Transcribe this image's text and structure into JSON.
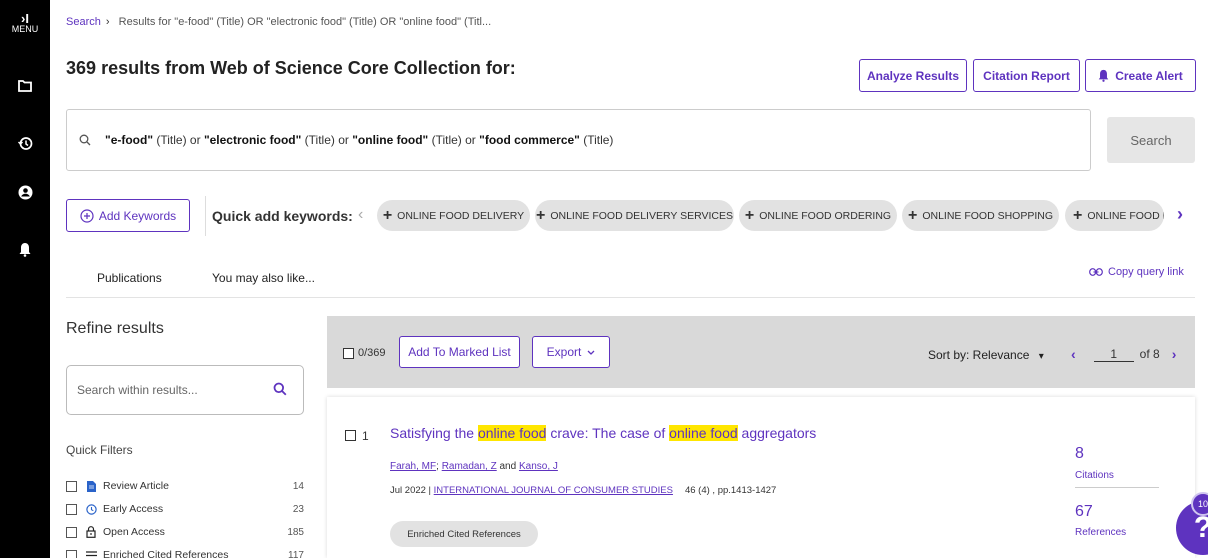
{
  "rail": {
    "menu_label": "MENU",
    "toggle_glyph": "›I",
    "icons": [
      "folder-icon",
      "history-icon",
      "account-icon",
      "bell-icon"
    ]
  },
  "breadcrumb": {
    "search": "Search",
    "separator": "›",
    "current": "Results for \"e-food\" (Title) OR \"electronic food\" (Title) OR \"online food\" (Titl..."
  },
  "header": {
    "count": "369",
    "title_rest": "results from Web of Science Core Collection for:",
    "analyze": "Analyze Results",
    "citation_report": "Citation Report",
    "create_alert": "Create Alert"
  },
  "query": {
    "t1": "\"e-food\"",
    "f1": " (Title) or ",
    "t2": "\"electronic food\"",
    "f2": " (Title) or ",
    "t3": "\"online food\"",
    "f3": " (Title) or ",
    "t4": "\"food commerce\"",
    "f4": " (Title)",
    "search_button": "Search"
  },
  "keywords": {
    "add_label": "Add Keywords",
    "quick_label": "Quick add keywords:",
    "chips": [
      "ONLINE FOOD DELIVERY",
      "ONLINE FOOD DELIVERY SERVICES",
      "ONLINE FOOD ORDERING",
      "ONLINE FOOD SHOPPING",
      "ONLINE FOOD D"
    ]
  },
  "tabs": {
    "publications": "Publications",
    "may_like": "You may also like...",
    "copy_link": "Copy query link"
  },
  "refine": {
    "title": "Refine results",
    "search_placeholder": "Search within results...",
    "quick_filters": "Quick Filters",
    "filters": [
      {
        "label": "Review Article",
        "count": "14",
        "icon": "document-icon"
      },
      {
        "label": "Early Access",
        "count": "23",
        "icon": "clock-icon"
      },
      {
        "label": "Open Access",
        "count": "185",
        "icon": "lock-icon"
      },
      {
        "label": "Enriched Cited References",
        "count": "117",
        "icon": "list-icon"
      }
    ]
  },
  "result_bar": {
    "selected": "0/369",
    "add_marked": "Add To Marked List",
    "export": "Export",
    "sort": "Sort by: Relevance",
    "sort_arrow": "▾",
    "page": "1",
    "of": "of 8"
  },
  "record": {
    "number": "1",
    "title_1": "Satisfying the ",
    "hl_1": "online food",
    "title_2": " crave: The case of ",
    "hl_2": "online food",
    "title_3": " aggregators",
    "author_1": "Farah, MF",
    "author_sep1": "; ",
    "author_2": "Ramadan, Z",
    "author_sep2": " and ",
    "author_3": "Kanso, J",
    "date": "Jul 2022 | ",
    "journal": "INTERNATIONAL JOURNAL OF CONSUMER STUDIES",
    "volume": "46 (4) , pp.1413-1427",
    "ecr_label": "Enriched Cited References",
    "citations_count": "8",
    "citations_label": "Citations",
    "references_count": "67",
    "references_label": "References"
  },
  "help": {
    "badge": "10",
    "glyph": "?"
  },
  "colors": {
    "accent": "#5e33bf",
    "highlight": "#ffe600",
    "rail": "#000000"
  }
}
